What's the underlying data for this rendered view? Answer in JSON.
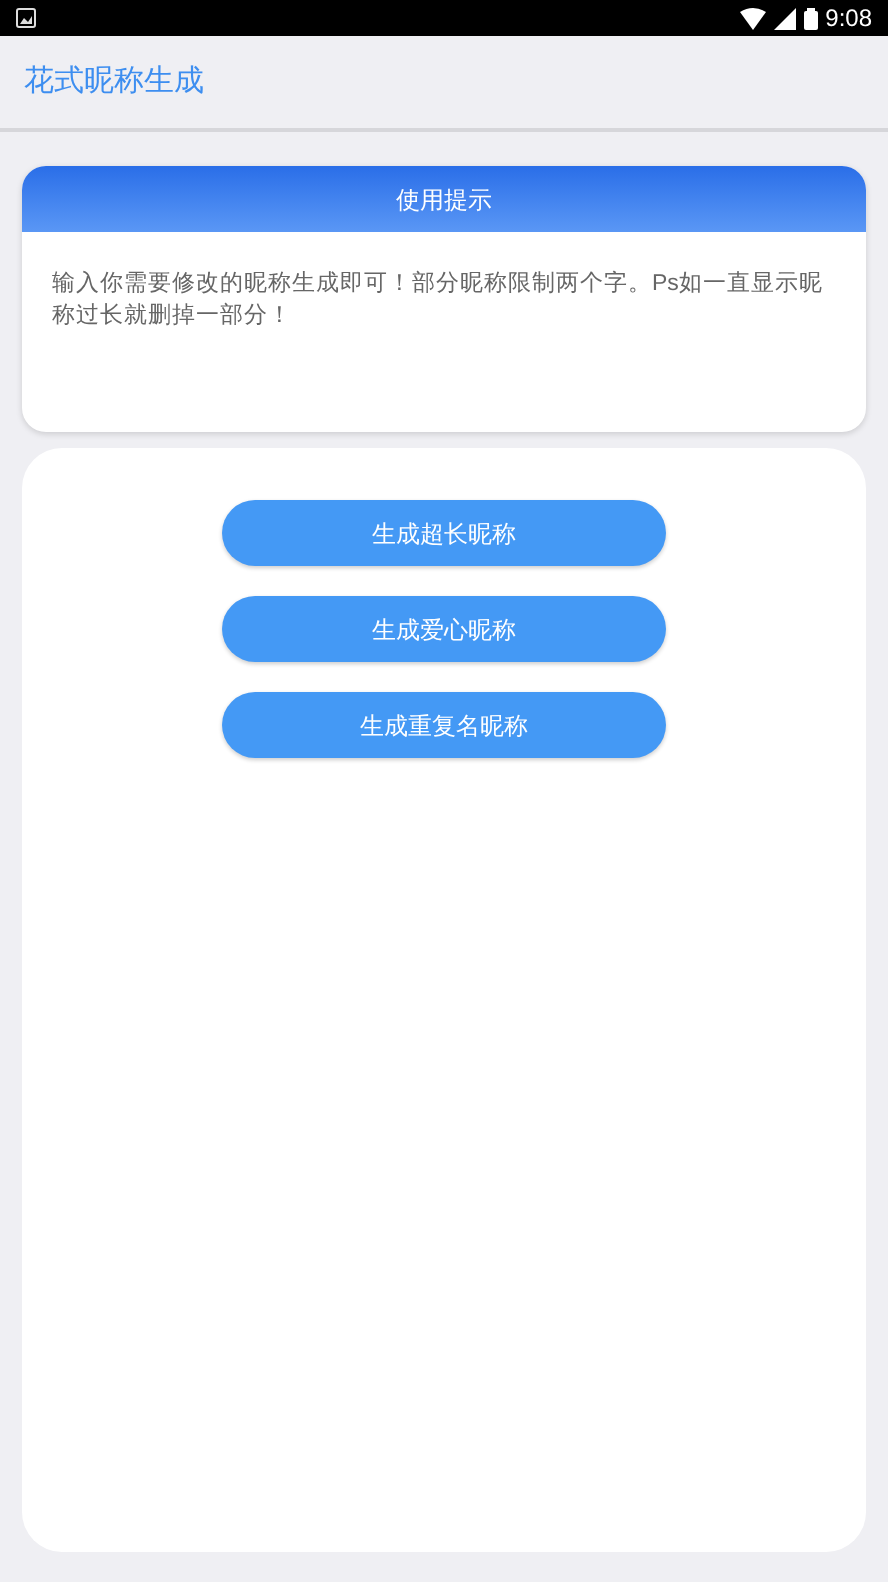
{
  "status_bar": {
    "time": "9:08"
  },
  "app_bar": {
    "title": "花式昵称生成"
  },
  "tip_card": {
    "title": "使用提示",
    "text": "输入你需要修改的昵称生成即可！部分昵称限制两个字。Ps如一直显示昵称过长就删掉一部分！"
  },
  "buttons": [
    {
      "label": "生成超长昵称"
    },
    {
      "label": "生成爱心昵称"
    },
    {
      "label": "生成重复名昵称"
    }
  ]
}
